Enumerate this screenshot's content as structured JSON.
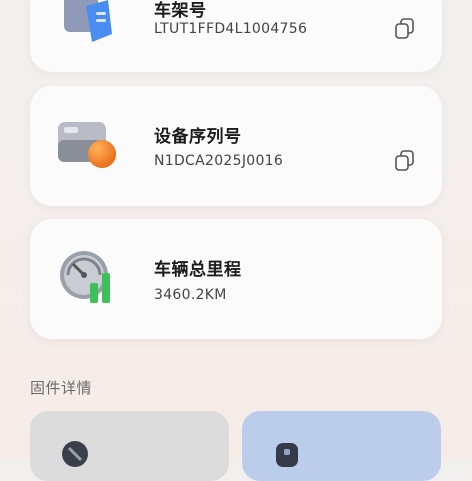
{
  "cards": [
    {
      "id": "vin",
      "title": "车架号",
      "value": "LTUT1FFD4L1004756",
      "icon": "document-icon",
      "copy_icon": "copy-icon"
    },
    {
      "id": "serial",
      "title": "设备序列号",
      "value": "N1DCA2025J0016",
      "icon": "device-icon",
      "copy_icon": "copy-icon"
    },
    {
      "id": "mileage",
      "title": "车辆总里程",
      "value": "3460.2KM",
      "icon": "gauge-icon"
    }
  ],
  "section": {
    "title": "固件详情"
  },
  "tiles": [
    {
      "icon": "firmware-icon",
      "color": "#dcdcdd"
    },
    {
      "icon": "chip-icon",
      "color": "#bccdec"
    }
  ],
  "colors": {
    "accent_orange": "#f08a24",
    "accent_green": "#3cc05a",
    "accent_blue": "#4a8df0"
  }
}
